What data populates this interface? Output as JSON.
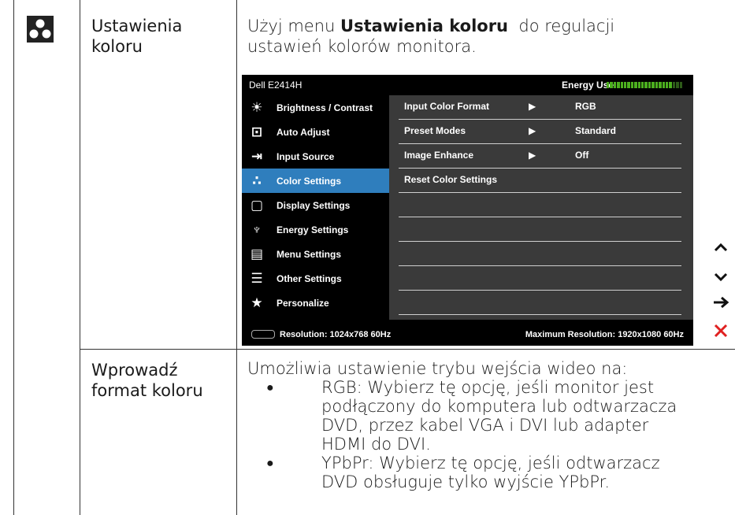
{
  "row1": {
    "icon": "color-settings-icon",
    "label_line1": "Ustawienia",
    "label_line2": "koloru",
    "desc_line1_pre": "Użyj menu ",
    "desc_line1_bold": "Ustawienia koloru",
    "desc_line1_post": "  do regulacji",
    "desc_line2": "ustawień kolorów monitora."
  },
  "osd": {
    "model": "Dell E2414H",
    "energy_label": "Energy Use",
    "energy_level": 0.85,
    "menu": [
      {
        "label": "Brightness / Contrast",
        "icon": "brightness-icon"
      },
      {
        "label": "Auto Adjust",
        "icon": "auto-adjust-icon"
      },
      {
        "label": "Input Source",
        "icon": "input-source-icon"
      },
      {
        "label": "Color Settings",
        "icon": "color-settings-icon",
        "active": true
      },
      {
        "label": "Display Settings",
        "icon": "display-settings-icon"
      },
      {
        "label": "Energy Settings",
        "icon": "energy-settings-icon"
      },
      {
        "label": "Menu Settings",
        "icon": "menu-settings-icon"
      },
      {
        "label": "Other Settings",
        "icon": "other-settings-icon"
      },
      {
        "label": "Personalize",
        "icon": "star-icon"
      }
    ],
    "submenu": [
      {
        "name": "Input Color Format",
        "arrow": "▶",
        "value": "RGB"
      },
      {
        "name": "Preset Modes",
        "arrow": "▶",
        "value": "Standard"
      },
      {
        "name": "Image Enhance",
        "arrow": "▶",
        "value": "Off"
      },
      {
        "name": "Reset Color Settings",
        "arrow": "",
        "value": ""
      },
      {
        "name": "",
        "arrow": "",
        "value": ""
      },
      {
        "name": "",
        "arrow": "",
        "value": ""
      },
      {
        "name": "",
        "arrow": "",
        "value": ""
      },
      {
        "name": "",
        "arrow": "",
        "value": ""
      },
      {
        "name": "",
        "arrow": "",
        "value": ""
      }
    ],
    "resolution": "Resolution:  1024x768 60Hz",
    "max_resolution": "Maximum Resolution: 1920x1080 60Hz",
    "active_color": "#2f7ebd",
    "submenu_bg": "#3a3a3a"
  },
  "nav_buttons": [
    {
      "name": "up-icon",
      "glyph": "⌃"
    },
    {
      "name": "down-icon",
      "glyph": "⌄"
    },
    {
      "name": "right-arrow-icon",
      "glyph": "→"
    },
    {
      "name": "close-icon",
      "glyph": "✕"
    }
  ],
  "row2": {
    "label_line1": "Wprowadź",
    "label_line2": "format koloru",
    "intro": "Umożliwia ustawienie trybu wejścia wideo na:",
    "bullets": [
      [
        "RGB: Wybierz tę opcję, jeśli monitor jest",
        "podłączony do komputera lub odtwarzacza",
        "DVD, przez kabel VGA i DVI lub adapter",
        "HDMI do DVI."
      ],
      [
        "YPbPr: Wybierz tę opcję, jeśli odtwarzacz",
        "DVD obsługuje tylko wyjście YPbPr."
      ]
    ]
  }
}
